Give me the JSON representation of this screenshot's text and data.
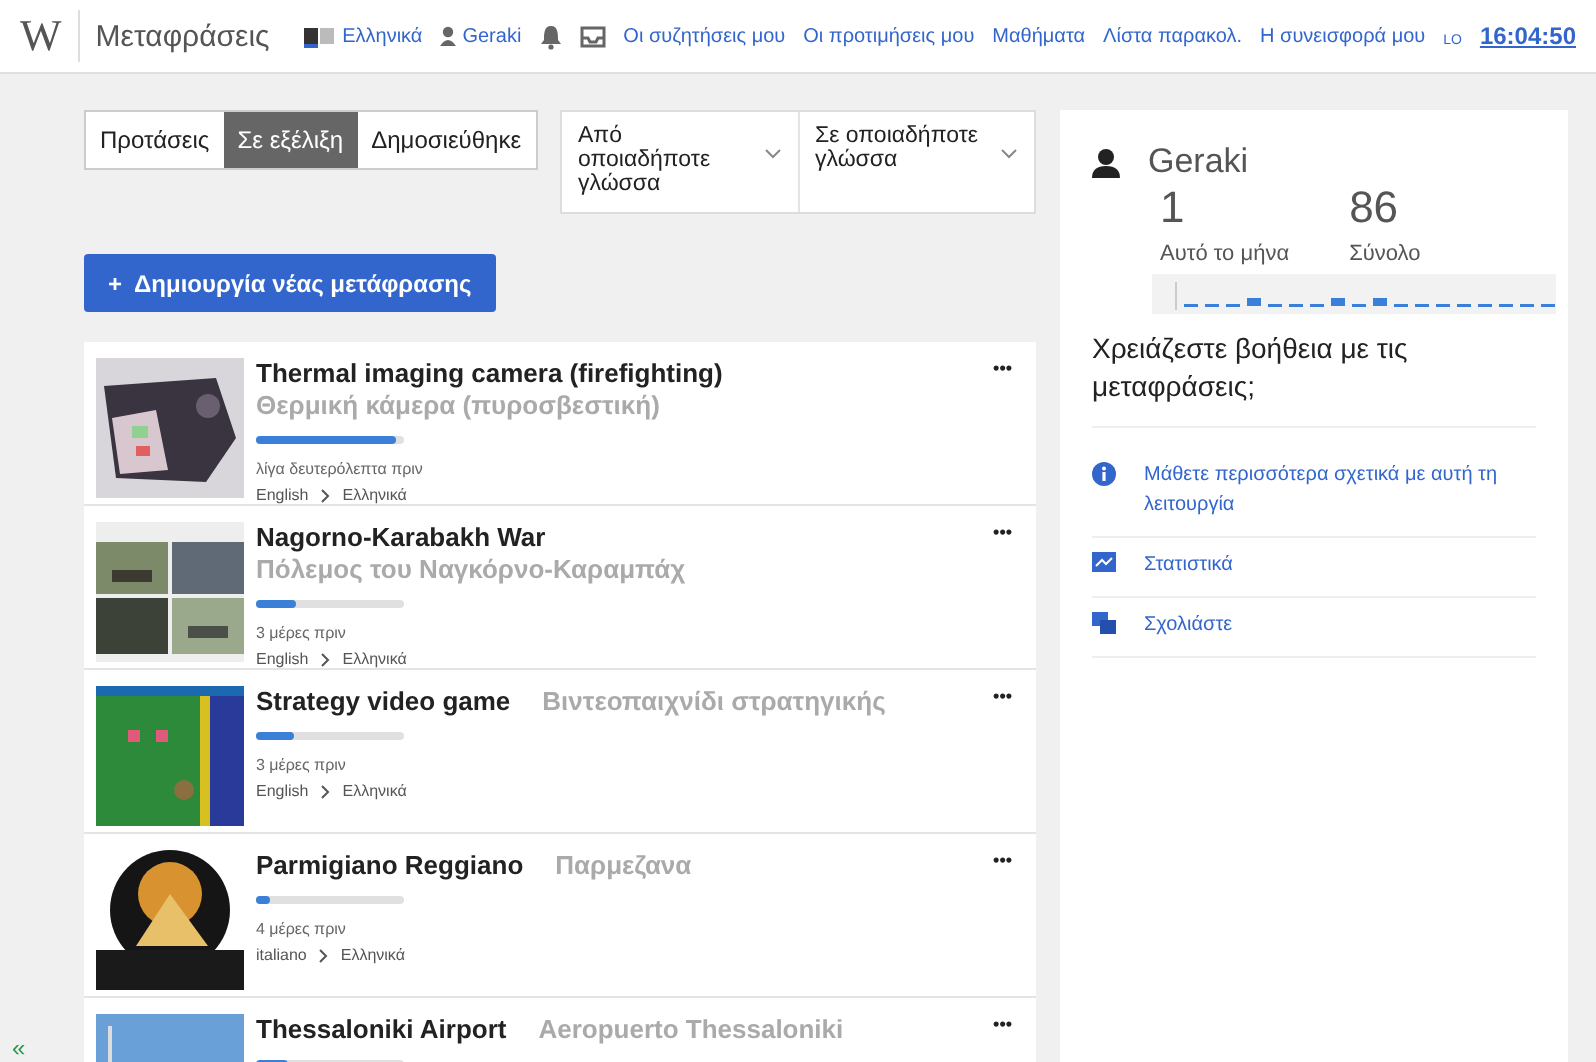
{
  "header": {
    "logo": "W",
    "title": "Μεταφράσεις",
    "language": "Ελληνικά",
    "user": "Geraki",
    "links": [
      "Οι συζητήσεις μου",
      "Οι προτιμήσεις μου",
      "Μαθήματα",
      "Λίστα παρακολ.",
      "Η συνεισφορά μου"
    ],
    "sup": "LO",
    "time": "16:04:50"
  },
  "tabs": [
    {
      "label": "Προτάσεις",
      "selected": false
    },
    {
      "label": "Σε εξέλιξη",
      "selected": true
    },
    {
      "label": "Δημοσιεύθηκε",
      "selected": false
    }
  ],
  "language_filter": {
    "from": "Από οποιαδήποτε γλώσσα",
    "to": "Σε οποιαδήποτε γλώσσα"
  },
  "create_button": {
    "icon": "+",
    "label": "Δημιουργία νέας μετάφρασης"
  },
  "translations": [
    {
      "kind": "picture",
      "title": "Thermal imaging camera (firefighting)",
      "target": "Θερμική κάμερα (πυροσβεστική)",
      "level": 0.95,
      "time": "λίγα δευτερόλεπτα πριν",
      "source_lang": "English",
      "target_lang": "Ελληνικά",
      "menu": "•••"
    },
    {
      "kind": "picture",
      "title": "Nagorno-Karabakh War",
      "target": "Πόλεμος του Ναγκόρνο-Καραμπάχ",
      "level": 0.27,
      "time": "3 μέρες πριν",
      "source_lang": "English",
      "target_lang": "Ελληνικά",
      "menu": "•••"
    },
    {
      "kind": "picture",
      "title": "Strategy video game",
      "target": "Βιντεοπαιχνίδι στρατηγικής",
      "level": 0.25,
      "time": "3 μέρες πριν",
      "source_lang": "English",
      "target_lang": "Ελληνικά",
      "menu": "•••"
    },
    {
      "kind": "picture",
      "title": "Parmigiano Reggiano",
      "target": "Παρμεζανα",
      "level": 0.1,
      "time": "4 μέρες πριν",
      "source_lang": "italiano",
      "target_lang": "Ελληνικά",
      "menu": "•••"
    },
    {
      "kind": "picture",
      "title": "Thessaloniki Airport",
      "target": "Aeropuerto Thessaloniki",
      "level": 0.22,
      "menu": "•••"
    }
  ],
  "sidebar": {
    "user": "Geraki",
    "stats": [
      {
        "value": "1",
        "label": "Αυτό το μήνα"
      },
      {
        "value": "86",
        "label": "Σύνολο"
      }
    ],
    "help_title": "Χρειάζεστε βοήθεια με τις μεταφράσεις;",
    "help_links": [
      {
        "kind": "info",
        "label": "Μάθετε περισσότερα σχετικά με αυτή τη λειτουργία"
      },
      {
        "kind": "stats",
        "label": "Στατιστικά"
      },
      {
        "kind": "feedback",
        "label": "Σχολιάστε"
      }
    ]
  },
  "collapse": "«"
}
